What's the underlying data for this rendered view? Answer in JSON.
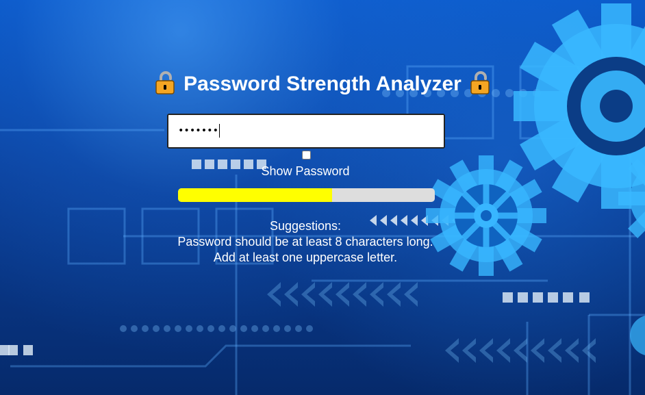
{
  "header": {
    "title": "Password Strength Analyzer",
    "icon_left": "lock-icon",
    "icon_right": "lock-icon"
  },
  "password_field": {
    "masked_value": "•••••••"
  },
  "show_password": {
    "label": "Show Password",
    "checked": false
  },
  "strength_meter": {
    "level": 0.6,
    "fill_color": "#ffff00",
    "track_color": "#dddddd"
  },
  "suggestions": {
    "heading": "Suggestions:",
    "items": [
      "Password should be at least 8 characters long.",
      "Add at least one uppercase letter."
    ]
  },
  "colors": {
    "background": "#0a4fb8",
    "text": "#ffffff"
  }
}
